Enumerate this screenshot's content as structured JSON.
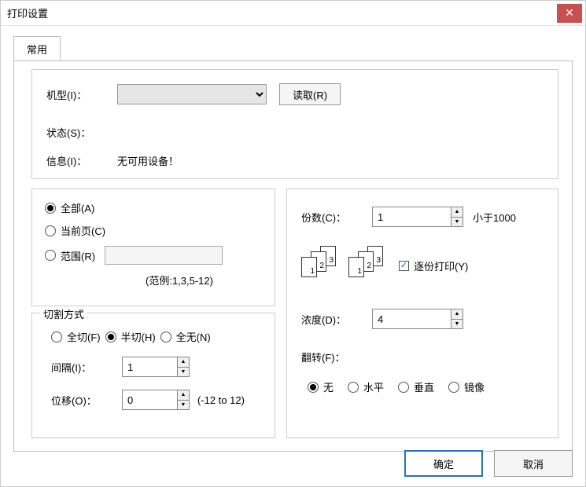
{
  "window": {
    "title": "打印设置"
  },
  "tabs": {
    "general": "常用"
  },
  "device": {
    "model_label": "机型(I)：",
    "read_btn": "读取(R)",
    "status_label": "状态(S)：",
    "info_label": "信息(I)：",
    "info_value": "无可用设备！"
  },
  "scope": {
    "all": "全部(A)",
    "current": "当前页(C)",
    "range": "范围(R)",
    "range_hint": "(范例:1,3,5-12)"
  },
  "cut": {
    "legend": "切割方式",
    "full": "全切(F)",
    "half": "半切(H)",
    "none": "全无(N)",
    "interval_label": "间隔(I)：",
    "interval_value": "1",
    "offset_label": "位移(O)：",
    "offset_value": "0",
    "offset_hint": "(-12 to 12)"
  },
  "right": {
    "copies_label": "份数(C)：",
    "copies_value": "1",
    "copies_hint": "小于1000",
    "collate_label": "逐份打印(Y)",
    "density_label": "浓度(D)：",
    "density_value": "4",
    "flip_label": "翻转(F)：",
    "flip_none": "无",
    "flip_h": "水平",
    "flip_v": "垂直",
    "flip_mirror": "镜像"
  },
  "footer": {
    "ok": "确定",
    "cancel": "取消"
  }
}
